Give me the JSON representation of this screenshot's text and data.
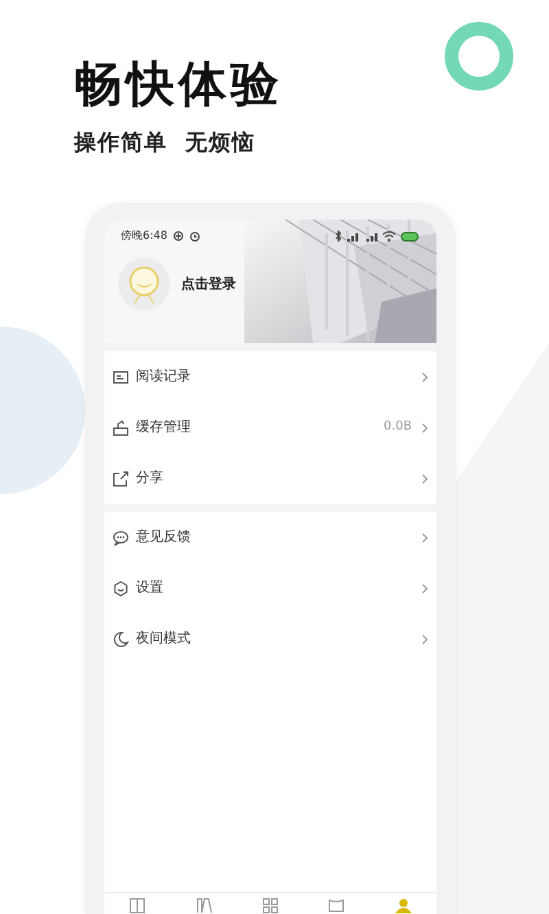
{
  "promo": {
    "headline": "畅快体验",
    "tagline": "操作简单  无烦恼"
  },
  "status_bar": {
    "time": "傍晚6:48"
  },
  "profile": {
    "login": "点击登录"
  },
  "menu_groups": [
    {
      "items": [
        {
          "kind": "history",
          "label": "阅读记录"
        },
        {
          "kind": "cache",
          "label": "缓存管理",
          "value": "0.0B"
        },
        {
          "kind": "share",
          "label": "分享"
        }
      ]
    },
    {
      "items": [
        {
          "kind": "feedback",
          "label": "意见反馈"
        },
        {
          "kind": "settings",
          "label": "设置"
        },
        {
          "kind": "night",
          "label": "夜间模式"
        }
      ]
    }
  ],
  "tabs": [
    {
      "kind": "book",
      "selected": false
    },
    {
      "kind": "shelf",
      "selected": false
    },
    {
      "kind": "grid",
      "selected": false
    },
    {
      "kind": "box",
      "selected": false
    },
    {
      "kind": "person",
      "selected": true
    }
  ]
}
